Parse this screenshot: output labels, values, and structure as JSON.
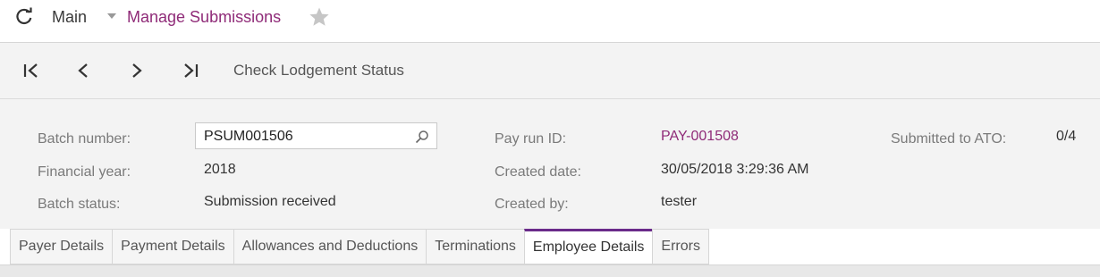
{
  "titlebar": {
    "refresh_icon": "refresh-icon",
    "breadcrumb": "Main",
    "caret_icon": "caret-down-icon",
    "screen_title": "Manage Submissions",
    "favorite_icon": "star-icon"
  },
  "toolbar": {
    "first_icon": "first-record-icon",
    "prev_icon": "previous-record-icon",
    "next_icon": "next-record-icon",
    "last_icon": "last-record-icon",
    "action_label": "Check Lodgement Status"
  },
  "form": {
    "batch_number_label": "Batch number:",
    "batch_number_value": "PSUM001506",
    "financial_year_label": "Financial year:",
    "financial_year_value": "2018",
    "batch_status_label": "Batch status:",
    "batch_status_value": "Submission received",
    "pay_run_id_label": "Pay run ID:",
    "pay_run_id_value": "PAY-001508",
    "created_date_label": "Created date:",
    "created_date_value": "30/05/2018 3:29:36 AM",
    "created_by_label": "Created by:",
    "created_by_value": "tester",
    "submitted_label": "Submitted to ATO:",
    "submitted_value": "0/4"
  },
  "tabs": [
    {
      "label": "Payer Details"
    },
    {
      "label": "Payment Details"
    },
    {
      "label": "Allowances and Deductions"
    },
    {
      "label": "Terminations"
    },
    {
      "label": "Employee Details",
      "active": true
    },
    {
      "label": "Errors"
    }
  ],
  "colors": {
    "accent": "#8f2b78",
    "active_tab_border": "#6a2a8a",
    "panel_bg": "#f3f3f3"
  }
}
